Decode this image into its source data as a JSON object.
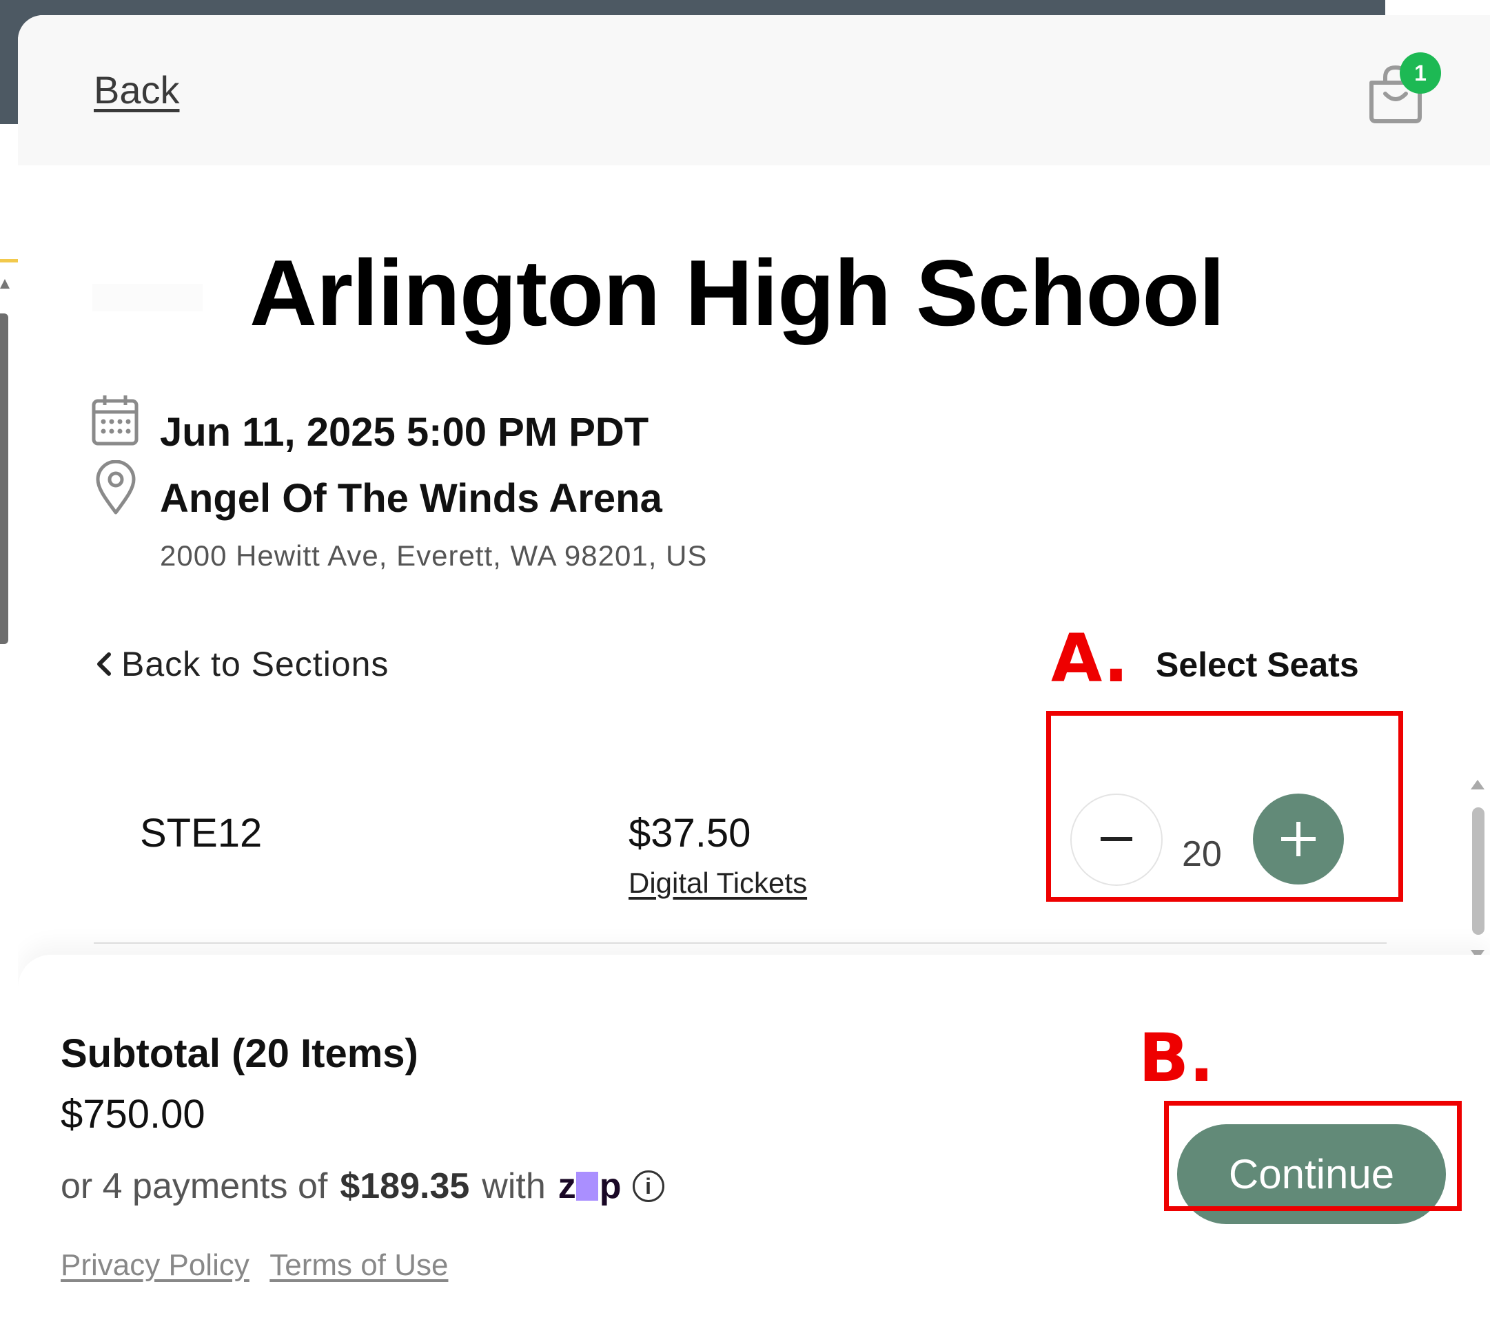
{
  "header": {
    "back_label": "Back",
    "cart_count": "1"
  },
  "event": {
    "title": "Arlington High School",
    "date": "Jun 11, 2025 5:00 PM PDT",
    "venue": "Angel Of The Winds Arena",
    "address": "2000 Hewitt Ave, Everett, WA 98201, US"
  },
  "seats": {
    "back_to_sections": "Back to Sections",
    "heading": "Select Seats",
    "rows": [
      {
        "name": "STE12",
        "price": "$37.50",
        "delivery": "Digital Tickets",
        "quantity": "20"
      }
    ]
  },
  "footer": {
    "subtotal_label": "Subtotal (20 Items)",
    "subtotal_value": "$750.00",
    "payments_prefix": "or 4 payments of",
    "payments_amount": "$189.35",
    "payments_with": "with",
    "zip_logo_text": "zip",
    "privacy_policy": "Privacy Policy",
    "terms_of_use": "Terms of Use",
    "continue_label": "Continue"
  },
  "annotations": {
    "a": "A.",
    "b": "B."
  },
  "colors": {
    "accent_green": "#628a78",
    "badge_green": "#1db954",
    "annotation_red": "#ee0000"
  }
}
